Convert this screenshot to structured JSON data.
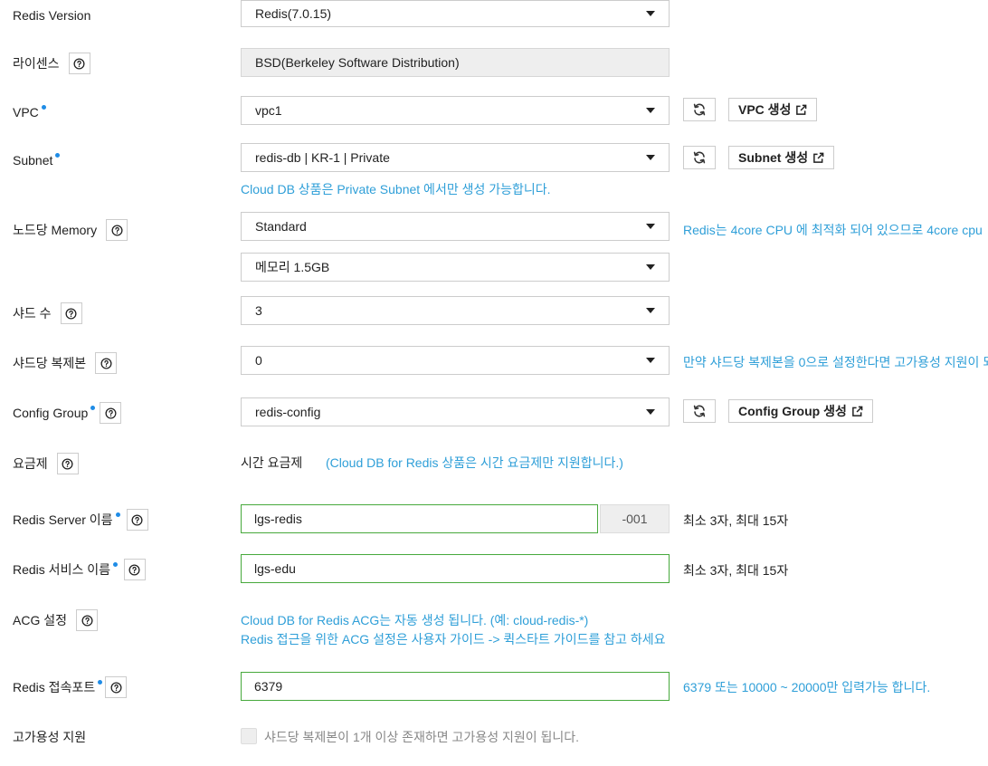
{
  "fields": {
    "redis_version": {
      "label": "Redis Version",
      "value": "Redis(7.0.15)"
    },
    "license": {
      "label": "라이센스",
      "value": "BSD(Berkeley Software Distribution)"
    },
    "vpc": {
      "label": "VPC",
      "value": "vpc1",
      "create_button": "VPC 생성"
    },
    "subnet": {
      "label": "Subnet",
      "value": "redis-db | KR-1 | Private",
      "create_button": "Subnet 생성",
      "hint": "Cloud DB 상품은 Private Subnet 에서만 생성 가능합니다."
    },
    "node_memory": {
      "label": "노드당 Memory",
      "type_value": "Standard",
      "memory_value": "메모리 1.5GB",
      "hint": "Redis는 4core CPU 에 최적화 되어 있으므로 4core cpu"
    },
    "shard_count": {
      "label": "샤드 수",
      "value": "3"
    },
    "shard_replica": {
      "label": "샤드당 복제본",
      "value": "0",
      "hint": "만약 샤드당 복제본을 0으로 설정한다면 고가용성 지원이 되"
    },
    "config_group": {
      "label": "Config Group",
      "value": "redis-config",
      "create_button": "Config Group 생성"
    },
    "pricing": {
      "label": "요금제",
      "value": "시간 요금제",
      "note": "(Cloud DB for Redis 상품은 시간 요금제만 지원합니다.)"
    },
    "server_name": {
      "label": "Redis Server 이름",
      "value": "lgs-redis",
      "suffix": "-001",
      "hint": "최소 3자, 최대 15자"
    },
    "service_name": {
      "label": "Redis 서비스 이름",
      "value": "lgs-edu",
      "hint": "최소 3자, 최대 15자"
    },
    "acg": {
      "label": "ACG 설정",
      "line1": "Cloud DB for Redis ACG는 자동 생성 됩니다. (예: cloud-redis-*)",
      "line2": "Redis 접근을 위한 ACG 설정은 사용자 가이드 -> 퀵스타트 가이드를 참고 하세요"
    },
    "port": {
      "label": "Redis 접속포트",
      "value": "6379",
      "hint": "6379 또는 10000 ~ 20000만 입력가능 합니다."
    },
    "ha": {
      "label": "고가용성 지원",
      "checkbox_label": "샤드당 복제본이 1개 이상 존재하면 고가용성 지원이 됩니다.",
      "checked": false
    }
  },
  "icons": {
    "help": "question-circle-icon",
    "refresh": "refresh-icon",
    "external": "external-link-icon",
    "dropdown": "caret-down-icon",
    "required": "required-dot-icon"
  },
  "colors": {
    "hint": "#2f9fd8",
    "required_dot": "#1f8ce6",
    "valid_border": "#47a93c",
    "disabled_bg": "#eeeeee"
  }
}
